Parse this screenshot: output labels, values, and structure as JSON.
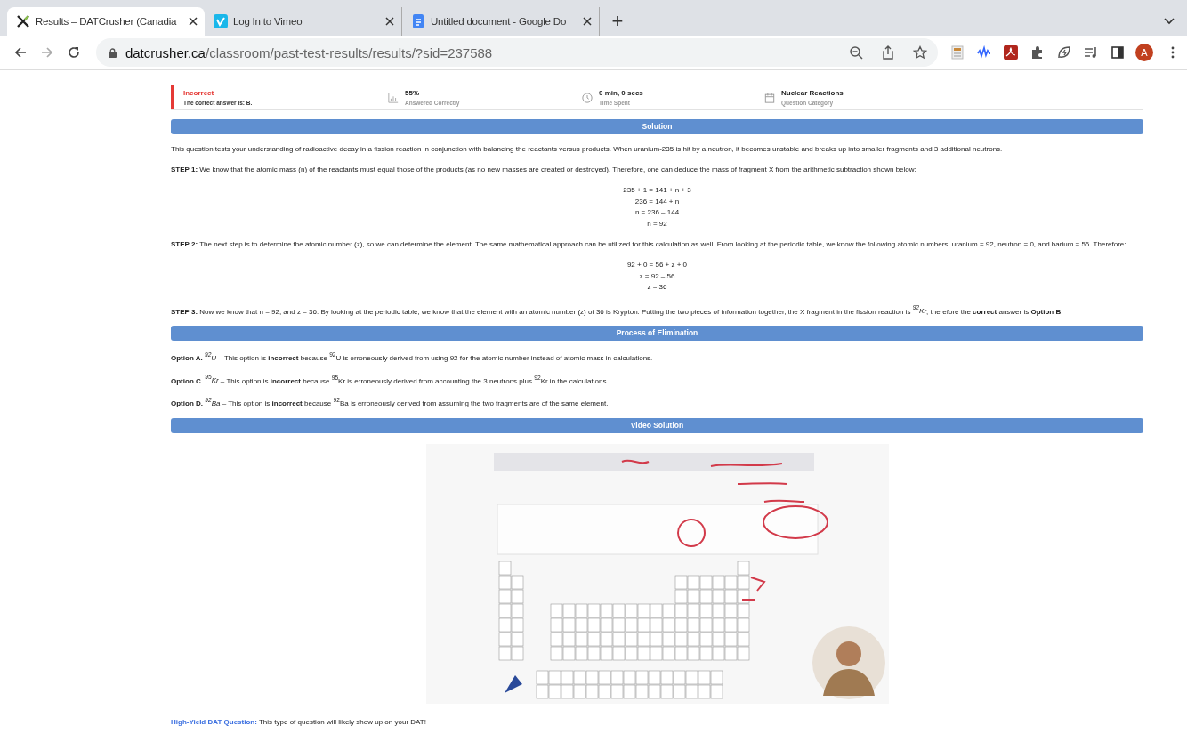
{
  "browser": {
    "tabs": [
      {
        "title": "Results – DATCrusher (Canadia",
        "selected": true,
        "kind": "dat"
      },
      {
        "title": "Log In to Vimeo",
        "selected": false,
        "kind": "vimeo"
      },
      {
        "title": "Untitled document - Google Do",
        "selected": false,
        "kind": "docs"
      }
    ],
    "new_tab": "+",
    "url_host": "datcrusher.ca",
    "url_path": "/classroom/past-test-results/results/?sid=237588",
    "avatar": "A"
  },
  "summary": [
    {
      "kind": "result",
      "title": "Incorrect",
      "subtitle": "The correct answer is: B.",
      "correct": false
    },
    {
      "kind": "chart",
      "title": "55%",
      "subtitle": "Answered Correctly"
    },
    {
      "kind": "clock",
      "title": "0 min, 0 secs",
      "subtitle": "Time Spent"
    },
    {
      "kind": "calendar",
      "title": "Nuclear Reactions",
      "subtitle": "Question Category"
    }
  ],
  "solution": {
    "heading": "Solution",
    "blocks": [
      {
        "kind": "para",
        "text": "This question tests your understanding of radioactive decay in a fission reaction in conjunction with balancing the reactants versus products. When uranium-235 is hit by a neutron, it becomes unstable and breaks up into smaller fragments and 3 additional neutrons."
      },
      {
        "kind": "para",
        "text": "**STEP 1:** We know that the atomic mass (n) of the reactants must equal those of the products (as no new masses are created or destroyed). Therefore, one can deduce the mass of fragment X from the arithmetic subtraction shown below:"
      },
      {
        "kind": "math",
        "lines": [
          "235 + 1 = 141 + n + 3",
          "236 = 144 + n",
          "n = 236 – 144",
          "n = 92"
        ]
      },
      {
        "kind": "para",
        "text": "**STEP 2:** The next step is to determine the atomic number (z), so we can determine the element. The same mathematical approach can be utilized for this calculation as well. From looking at the periodic table, we know the following atomic numbers: uranium = 92, neutron = 0, and barium = 56. Therefore:"
      },
      {
        "kind": "math",
        "lines": [
          "92 + 0 = 56 + z + 0",
          "z = 92 – 56",
          "z = 36"
        ]
      },
      {
        "kind": "para",
        "text": "**STEP 3:** Now we know that n = 92, and z = 36. By looking at the periodic table, we know that the element with an atomic number (z) of 36 is Krypton. Putting the two pieces of information together, the X fragment in the fission reaction is *$^{92}$Kr*, therefore the **correct** answer is **Option B**."
      }
    ]
  },
  "elimination": {
    "heading": "Process of Elimination",
    "options": [
      "**Option A.** *$^{92}$U* – This option is **incorrect** because $^{92}$U is erroneously derived from using 92 for the atomic number instead of atomic mass in calculations.",
      "**Option C.** *$^{95}$Kr* – This option is **incorrect** because $^{95}$Kr is erroneously derived from accounting the 3 neutrons plus $^{92}$Kr in the calculations.",
      "**Option D.** *$^{92}$Ba* – This option is **incorrect** because $^{92}$Ba is erroneously derived from assuming the two fragments are of the same element."
    ]
  },
  "video": {
    "heading": "Video Solution",
    "kind": "picture"
  },
  "footer": {
    "label": "High-Yield DAT Question:",
    "text": "This type of question will likely show up on your DAT!"
  }
}
